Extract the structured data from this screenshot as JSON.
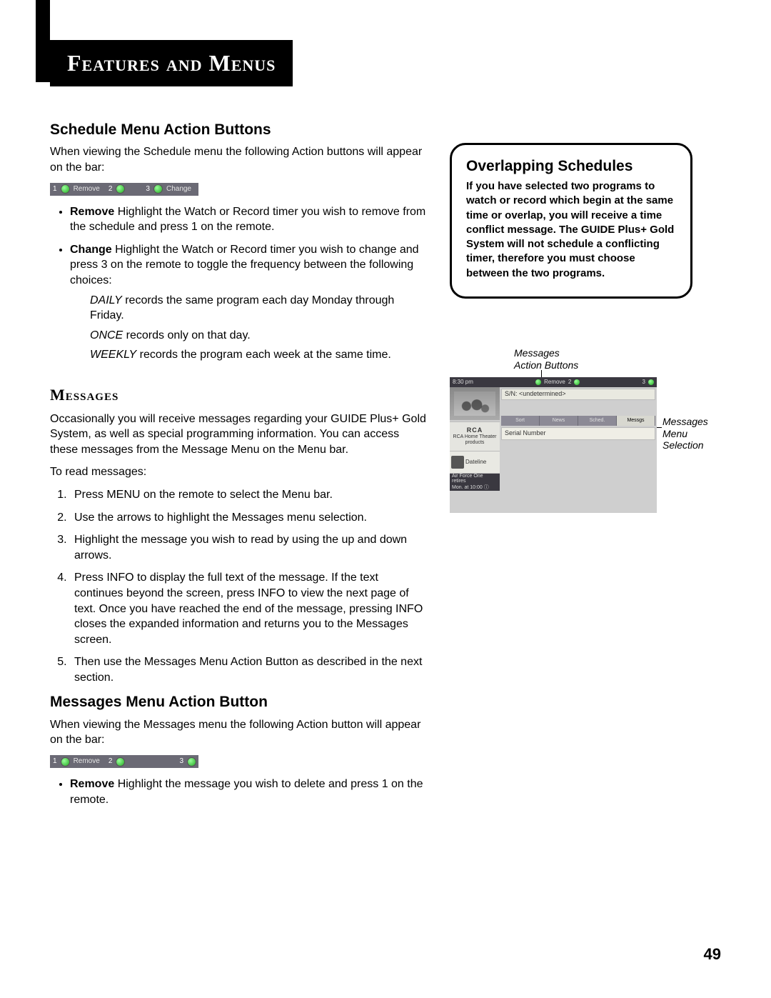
{
  "chapter_title": "Features and Menus",
  "left": {
    "schedule_hdr": "Schedule Menu Action Buttons",
    "schedule_intro": "When viewing the Schedule menu the following Action buttons will appear on the bar:",
    "bar1": {
      "n1": "1",
      "l1": "Remove",
      "n2": "2",
      "l2": "",
      "n3": "3",
      "l3": "Change"
    },
    "remove_label": "Remove",
    "remove_text": "   Highlight the Watch or Record timer you wish to remove from the schedule and press 1 on the remote.",
    "change_label": "Change",
    "change_text": "   Highlight the Watch or Record timer you wish to change and press 3 on the remote to toggle the frequency between the following choices:",
    "daily_label": "DAILY",
    "daily_text": "   records the same program each day Monday through Friday.",
    "once_label": "ONCE",
    "once_text": "   records only on that day.",
    "weekly_label": "WEEKLY",
    "weekly_text": "   records the program each week at the same time.",
    "messages_hdr": "Messages",
    "messages_intro": "Occasionally you will receive messages regarding your GUIDE Plus+ Gold System, as well as special programming information.  You can access these messages from the Message Menu on the Menu bar.",
    "messages_lead": "To read messages:",
    "steps": [
      "Press MENU on the remote to select the Menu bar.",
      "Use the arrows to highlight the Messages menu selection.",
      "Highlight the message you wish to read by using the up and down arrows.",
      "Press INFO to display the full text of the message. If the text continues beyond the screen, press INFO to view the next page of text. Once you have reached the end of the message, pressing INFO closes the expanded information and returns you to the Messages screen.",
      "Then use the Messages Menu Action Button as described in the next section."
    ],
    "mm_action_hdr": "Messages Menu Action Button",
    "mm_action_intro": "When viewing the Messages menu the following Action button will appear on the bar:",
    "bar2": {
      "n1": "1",
      "l1": "Remove",
      "n2": "2",
      "l2": "",
      "n3": "3",
      "l3": ""
    },
    "mm_remove_label": "Remove",
    "mm_remove_text": "   Highlight the message you wish to delete and press 1 on the remote."
  },
  "right": {
    "overlap_hdr": "Overlapping Schedules",
    "overlap_body": "If you have selected two programs to watch or record which begin at the same time or overlap, you will receive a time conflict message. The GUIDE Plus+ Gold System will not schedule a conflicting timer, therefore you must choose between the two programs.",
    "fig_label_top": "Messages\nAction Buttons",
    "fig_label_right": "Messages\nMenu\nSelection",
    "ss": {
      "time": "8:30 pm",
      "bar_l1": "Remove",
      "bar_n2": "2",
      "bar_n3": "3",
      "sn": "S/N: <undetermined>",
      "tabs": [
        "Sort",
        "News",
        "Sched.",
        "Messgs"
      ],
      "list0": "Serial Number",
      "rca": "RCA",
      "rca_tag": "RCA Home Theater products",
      "prog": "Dateline",
      "foot1": "Air Force One retires",
      "foot2": "Mon. at 10:00  ⓘ"
    }
  },
  "page_number": "49"
}
